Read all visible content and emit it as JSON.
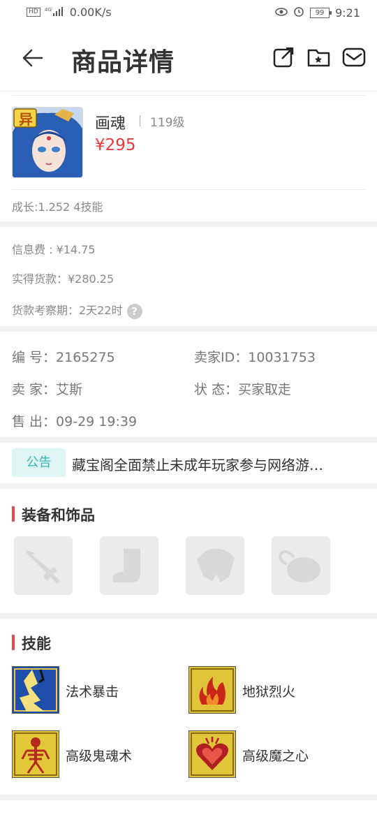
{
  "status_bar": {
    "network_badge": "HD",
    "signal": "4G",
    "speed": "0.00K/s",
    "battery": "99",
    "time": "9:21",
    "icons": [
      "eye-icon",
      "alarm-icon",
      "battery-icon",
      "signal-icon"
    ]
  },
  "header": {
    "title": "商品详情",
    "icons": [
      "back-arrow-icon",
      "share-icon",
      "folder-star-icon",
      "mail-icon"
    ]
  },
  "product": {
    "badge": "异",
    "name": "画魂",
    "level": "119级",
    "price": "¥295",
    "growth": "成长:1.252 4技能"
  },
  "fees": {
    "info_fee": "信息费 : ¥14.75",
    "received": "实得货款：¥280.25",
    "review_period": "货款考察期：2天22时",
    "help_glyph": "?"
  },
  "details": {
    "number": "编  号：2165275",
    "seller_id": "卖家ID：10031753",
    "seller": "卖  家：艾斯",
    "status": "状  态：买家取走",
    "sold": "售  出：09-29 19:39"
  },
  "notice": {
    "badge": "公告",
    "text": "藏宝阁全面禁止未成年玩家参与网络游…"
  },
  "equipment": {
    "title": "装备和饰品",
    "slots": [
      "sword-icon",
      "boot-icon",
      "armor-icon",
      "pouch-icon"
    ]
  },
  "skills": {
    "title": "技能",
    "items": [
      {
        "name": "法术暴击",
        "icon": "lightning-icon"
      },
      {
        "name": "地狱烈火",
        "icon": "fire-icon"
      },
      {
        "name": "高级鬼魂术",
        "icon": "skeleton-icon"
      },
      {
        "name": "高级魔之心",
        "icon": "heart-icon"
      }
    ]
  },
  "colors": {
    "price": "#e8393b",
    "accent_bar": "#e8494b",
    "notice_badge_bg": "#dff5f3",
    "notice_badge_text": "#3bb8b0",
    "divider": "#f2f2f2"
  }
}
